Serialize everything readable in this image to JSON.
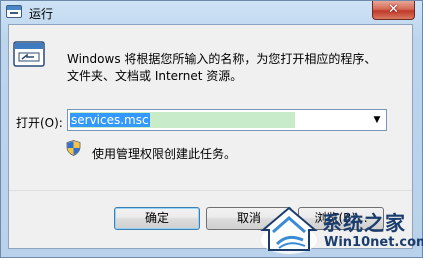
{
  "window": {
    "title": "运行",
    "close_glyph": "✕"
  },
  "message": {
    "line1": "Windows 将根据您所输入的名称，为您打开相应的程序、",
    "line2": "文件夹、文档或 Internet 资源。"
  },
  "open_field": {
    "label": "打开(O):",
    "value": "services.msc",
    "dropdown_glyph": "▼"
  },
  "admin_notice": "使用管理权限创建此任务。",
  "buttons": {
    "ok": "确定",
    "cancel": "取消",
    "browse": "浏览(B)..."
  },
  "watermark": {
    "brand": "系统之家",
    "url": "Win10net.com"
  },
  "icons": {
    "title": "run-app-icon",
    "dialog": "run-app-icon",
    "shield": "uac-shield-icon",
    "watermark": "house-logo-icon"
  },
  "colors": {
    "selection": "#3399ff",
    "field_highlight": "#c8ecc9",
    "close_button": "#c0392b"
  }
}
